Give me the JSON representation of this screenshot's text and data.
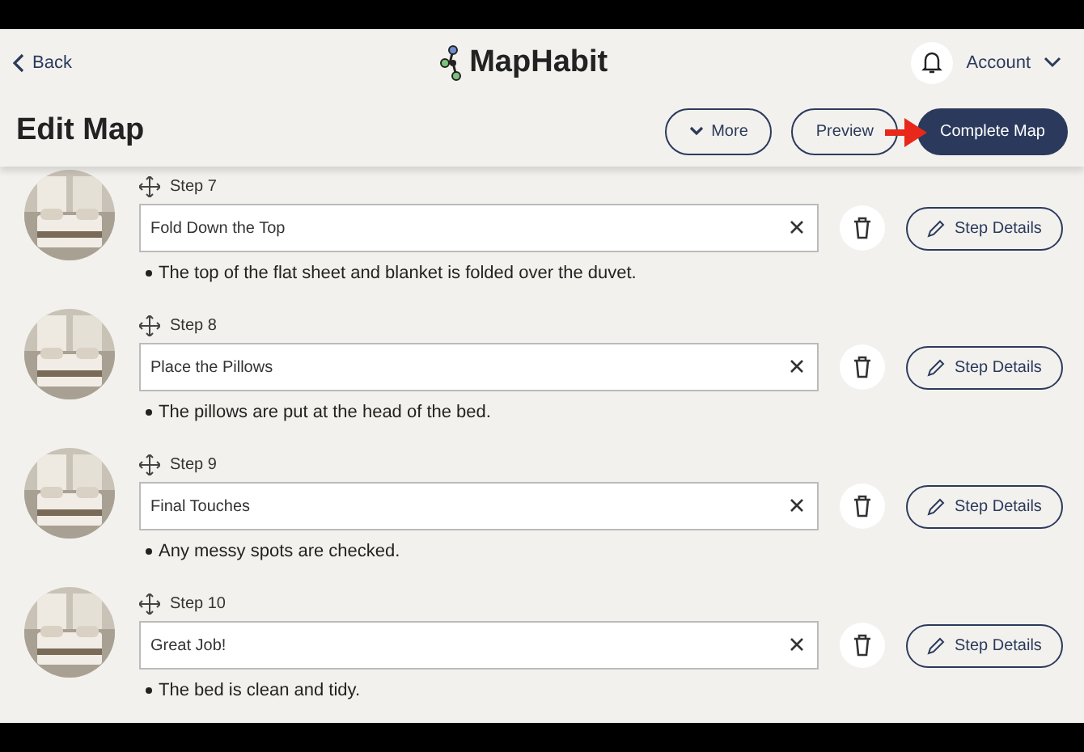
{
  "header": {
    "back": "Back",
    "logo": "MapHabit",
    "account": "Account"
  },
  "toolbar": {
    "title": "Edit Map",
    "buttons": [
      {
        "kind": "more",
        "label": "More"
      },
      {
        "kind": "outline",
        "label": "Preview"
      },
      {
        "kind": "primary",
        "label": "Complete Map"
      }
    ]
  },
  "steps": [
    {
      "label": "Step 7",
      "title": "Fold Down the Top",
      "note": "The top of the flat sheet and blanket is folded over the duvet.",
      "action": "Step Details"
    },
    {
      "label": "Step 8",
      "title": "Place the Pillows",
      "note": "The pillows are put at the head of the bed.",
      "action": "Step Details"
    },
    {
      "label": "Step 9",
      "title": "Final Touches",
      "note": "Any messy spots are checked.",
      "action": "Step Details"
    },
    {
      "label": "Step 10",
      "title": "Great Job!",
      "note": "The bed is clean and tidy.",
      "action": "Step Details"
    }
  ]
}
